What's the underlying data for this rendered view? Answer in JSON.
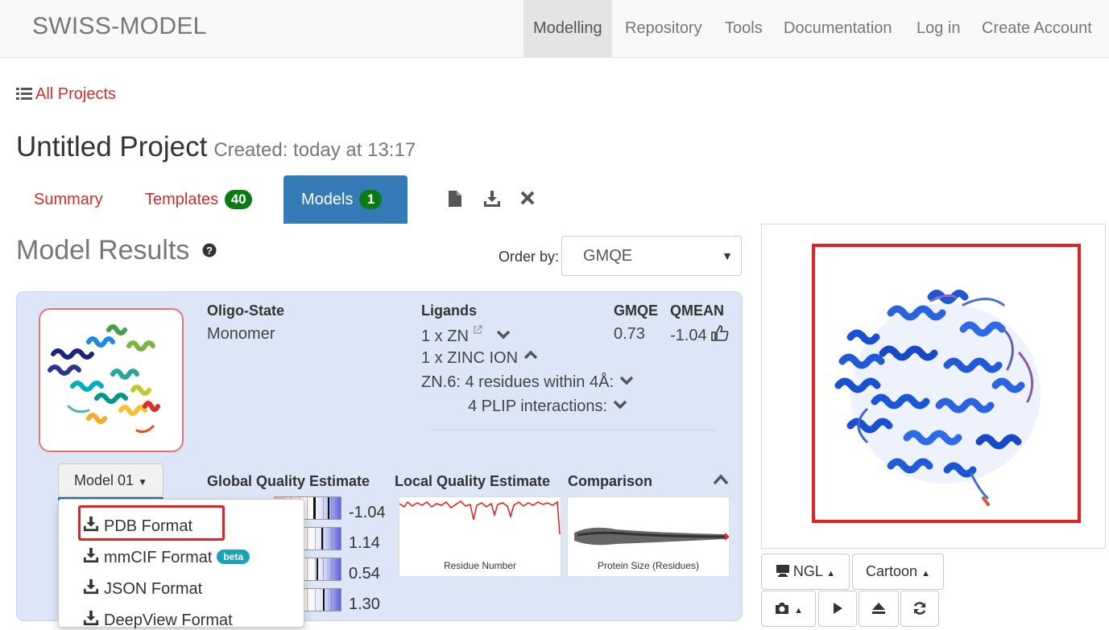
{
  "navbar": {
    "brand": "SWISS-MODEL",
    "items": [
      "Modelling",
      "Repository",
      "Tools",
      "Documentation",
      "Log in",
      "Create Account"
    ],
    "active": "Modelling"
  },
  "breadcrumb": {
    "all_projects": "All Projects"
  },
  "project": {
    "title": "Untitled Project",
    "created": "Created: today at 13:17"
  },
  "tabs": [
    {
      "label": "Summary"
    },
    {
      "label": "Templates",
      "badge": "40"
    },
    {
      "label": "Models",
      "badge": "1",
      "active": true
    }
  ],
  "toolbar_icons": [
    "file-icon",
    "download-icon",
    "close-icon"
  ],
  "results": {
    "title": "Model Results",
    "order_label": "Order by:",
    "order_value": "GMQE"
  },
  "model": {
    "oligo_state_label": "Oligo-State",
    "oligo_state": "Monomer",
    "ligands_label": "Ligands",
    "ligand_line1": "1 x ZN",
    "ligand_line2": "1 x ZINC ION",
    "ligand_site": "ZN.6:",
    "ligand_residues": "4 residues within 4Å:",
    "ligand_plip": "4 PLIP interactions:",
    "gmqe_label": "GMQE",
    "gmqe": "0.73",
    "qmean_label": "QMEAN",
    "qmean": "-1.04",
    "model_button": "Model 01",
    "global_quality_label": "Global Quality Estimate",
    "local_quality_label": "Local Quality Estimate",
    "comparison_label": "Comparison",
    "quality_values": [
      "-1.04",
      "1.14",
      "0.54",
      "1.30"
    ],
    "local_plot_caption": "Residue Number",
    "comparison_plot_caption": "Protein Size (Residues)"
  },
  "download_menu": {
    "items": [
      "PDB Format",
      "mmCIF Format",
      "JSON Format",
      "DeepView Format"
    ],
    "beta": "beta"
  },
  "viewer": {
    "buttons": [
      "NGL",
      "Cartoon"
    ],
    "icon_buttons": [
      "camera-icon",
      "play-icon",
      "eject-icon",
      "refresh-icon"
    ]
  },
  "colors": {
    "accent_red": "#c9302c",
    "tab_active": "#337ab7",
    "badge_green": "#0a7a12",
    "card_bg": "#dce6f6",
    "highlight": "#e32222"
  }
}
